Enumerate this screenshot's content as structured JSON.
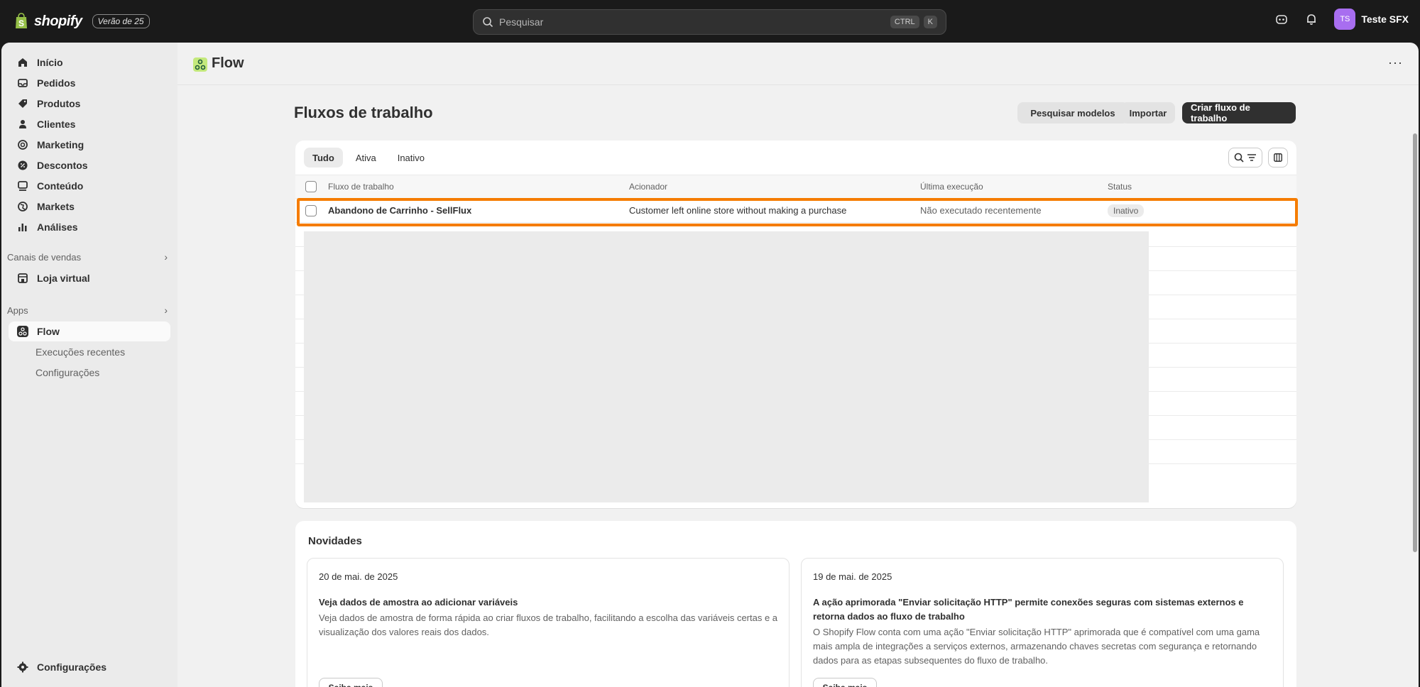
{
  "topbar": {
    "brand": "shopify",
    "edition": "Verão de 25",
    "search_placeholder": "Pesquisar",
    "shortcut_1": "CTRL",
    "shortcut_2": "K",
    "user_initials": "TS",
    "user_name": "Teste SFX"
  },
  "sidebar": {
    "items": [
      {
        "label": "Início",
        "icon": "home-icon"
      },
      {
        "label": "Pedidos",
        "icon": "inbox-icon"
      },
      {
        "label": "Produtos",
        "icon": "tag-icon"
      },
      {
        "label": "Clientes",
        "icon": "person-icon"
      },
      {
        "label": "Marketing",
        "icon": "target-icon"
      },
      {
        "label": "Descontos",
        "icon": "discount-icon"
      },
      {
        "label": "Conteúdo",
        "icon": "content-icon"
      },
      {
        "label": "Markets",
        "icon": "globe-icon"
      },
      {
        "label": "Análises",
        "icon": "chart-icon"
      }
    ],
    "sales_channels_label": "Canais de vendas",
    "online_store": "Loja virtual",
    "apps_label": "Apps",
    "flow_label": "Flow",
    "flow_sub_1": "Execuções recentes",
    "flow_sub_2": "Configurações",
    "settings": "Configurações"
  },
  "page": {
    "app_title": "Flow",
    "section_title": "Fluxos de trabalho",
    "btn_search_templates": "Pesquisar modelos",
    "btn_import": "Importar",
    "btn_create": "Criar fluxo de trabalho"
  },
  "tabs": [
    "Tudo",
    "Ativa",
    "Inativo"
  ],
  "table": {
    "columns": [
      "Fluxo de trabalho",
      "Acionador",
      "Última execução",
      "Status"
    ],
    "rows": [
      {
        "name": "Abandono de Carrinho - SellFlux",
        "trigger": "Customer left online store without making a purchase",
        "last_run": "Não executado recentemente",
        "status": "Inativo"
      }
    ]
  },
  "news": {
    "title": "Novidades",
    "items": [
      {
        "date": "20 de mai. de 2025",
        "headline": "Veja dados de amostra ao adicionar variáveis",
        "body": "Veja dados de amostra de forma rápida ao criar fluxos de trabalho, facilitando a escolha das variáveis certas e a visualização dos valores reais dos dados.",
        "cta": "Saiba mais"
      },
      {
        "date": "19 de mai. de 2025",
        "headline": "A ação aprimorada \"Enviar solicitação HTTP\" permite conexões seguras com sistemas externos e retorna dados ao fluxo de trabalho",
        "body": "O Shopify Flow conta com uma ação \"Enviar solicitação HTTP\" aprimorada que é compatível com uma gama mais ampla de integrações a serviços externos, armazenando chaves secretas com segurança e retornando dados para as etapas subsequentes do fluxo de trabalho.",
        "cta": "Saiba mais"
      }
    ]
  },
  "colors": {
    "highlight": "#f57c00",
    "primary_button": "#303030",
    "avatar": "#a86ef0"
  }
}
